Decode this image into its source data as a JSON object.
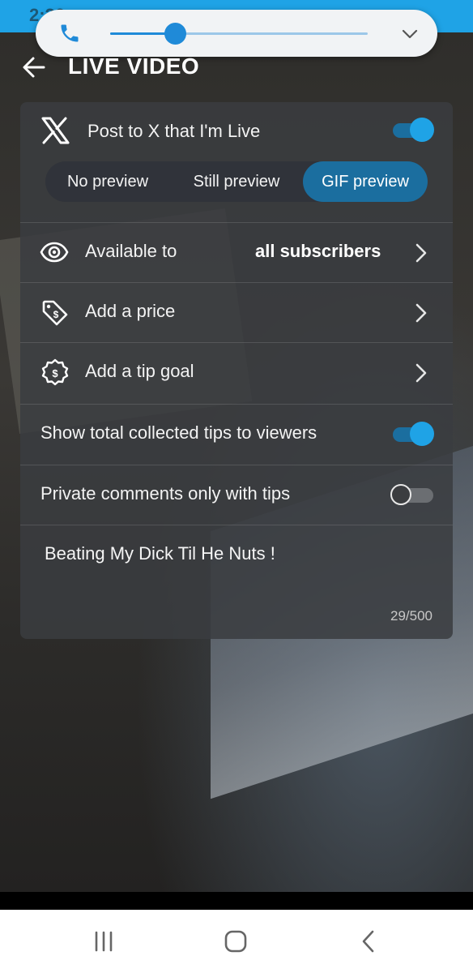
{
  "status_bar": {
    "time": "2:26"
  },
  "volume": {
    "level": 0.25
  },
  "header": {
    "title": "LIVE VIDEO"
  },
  "post_to_x": {
    "label": "Post to X that I'm Live",
    "enabled": true,
    "preview_options": [
      "No preview",
      "Still preview",
      "GIF preview"
    ],
    "selected_preview": "GIF preview"
  },
  "available_to": {
    "label": "Available to",
    "value": "all subscribers"
  },
  "add_price": {
    "label": "Add a price"
  },
  "tip_goal": {
    "label": "Add a tip goal"
  },
  "show_tips": {
    "label": "Show total collected tips to viewers",
    "enabled": true
  },
  "private_comments": {
    "label": "Private comments only with tips",
    "enabled": false
  },
  "description": {
    "text": "Beating My Dick Til He Nuts !",
    "counter": "29/500"
  },
  "colors": {
    "accent": "#1fa3e6",
    "toggle_track_on": "#1b6e9f",
    "status_bar": "#1fa3e6"
  },
  "icons": [
    "phone-icon",
    "chevron-down-icon",
    "back-arrow-icon",
    "x-logo-icon",
    "eye-icon",
    "price-tag-icon",
    "tip-goal-icon",
    "chevron-right-icon",
    "recents-icon",
    "home-icon",
    "nav-back-icon"
  ]
}
